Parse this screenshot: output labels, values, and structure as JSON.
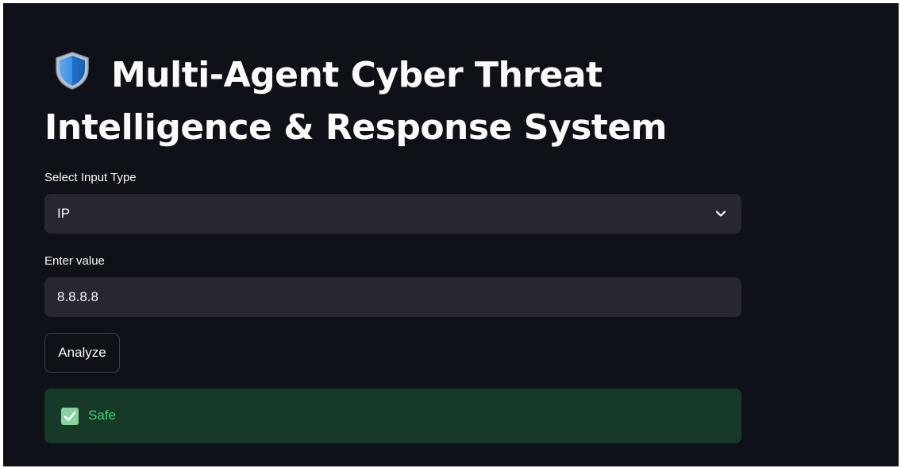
{
  "header": {
    "title": "Multi-Agent Cyber Threat Intelligence & Response System",
    "title_icon": "shield-icon"
  },
  "input_type": {
    "label": "Select Input Type",
    "selected": "IP",
    "icon": "chevron-down-icon"
  },
  "value_input": {
    "label": "Enter value",
    "value": "8.8.8.8"
  },
  "analyze_button": {
    "label": "Analyze"
  },
  "result": {
    "icon": "check-box-icon",
    "text": "Safe",
    "status": "success"
  },
  "colors": {
    "background": "#0e1117",
    "input_background": "#262730",
    "success_background": "#173928",
    "success_text": "#3dd56d",
    "text": "#fafafa"
  }
}
